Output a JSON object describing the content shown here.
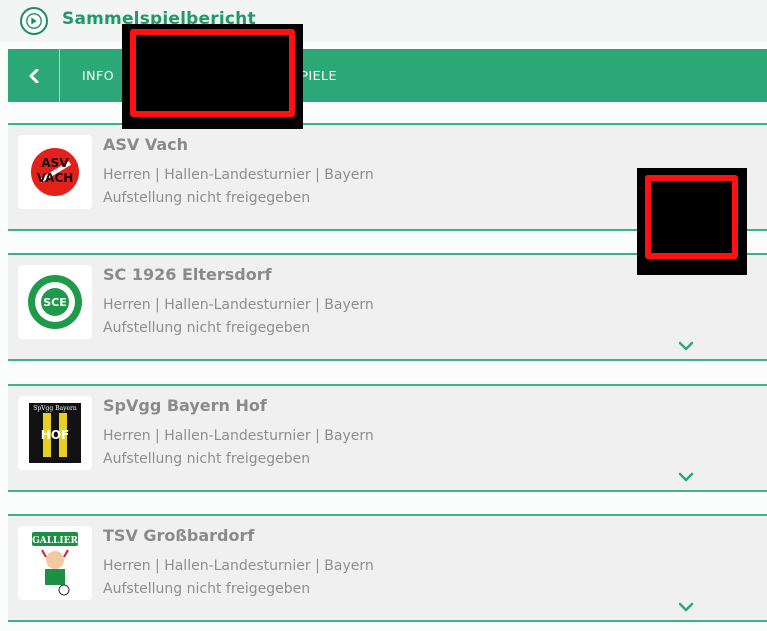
{
  "header": {
    "title": "Sammelspielbericht",
    "logo_icon": "dfb-logo-icon"
  },
  "nav": {
    "back_icon": "chevron-left-icon",
    "tabs": [
      {
        "label": "INFO"
      },
      {
        "label": ""
      },
      {
        "label": "SPIELE"
      }
    ]
  },
  "teams": [
    {
      "name": "ASV Vach",
      "league": "Herren | Hallen-Landesturnier | Bayern",
      "status": "Aufstellung nicht freigegeben",
      "logo_text_top": "ASV",
      "logo_text_bottom": "VACH"
    },
    {
      "name": "SC 1926 Eltersdorf",
      "league": "Herren | Hallen-Landesturnier | Bayern",
      "status": "Aufstellung nicht freigegeben",
      "logo_text": "SCE"
    },
    {
      "name": "SpVgg Bayern Hof",
      "league": "Herren | Hallen-Landesturnier | Bayern",
      "status": "Aufstellung nicht freigegeben",
      "logo_text_top": "SpVgg Bayern",
      "logo_text_bottom": "HOF"
    },
    {
      "name": "TSV Großbardorf",
      "league": "Herren | Hallen-Landesturnier | Bayern",
      "status": "Aufstellung nicht freigegeben",
      "logo_text": "GALLIER"
    }
  ],
  "colors": {
    "accent": "#2ca878",
    "title": "#1f9a67",
    "card_bg": "#f0f0f0",
    "redaction": "#000000",
    "redaction_border": "#ff1111"
  }
}
